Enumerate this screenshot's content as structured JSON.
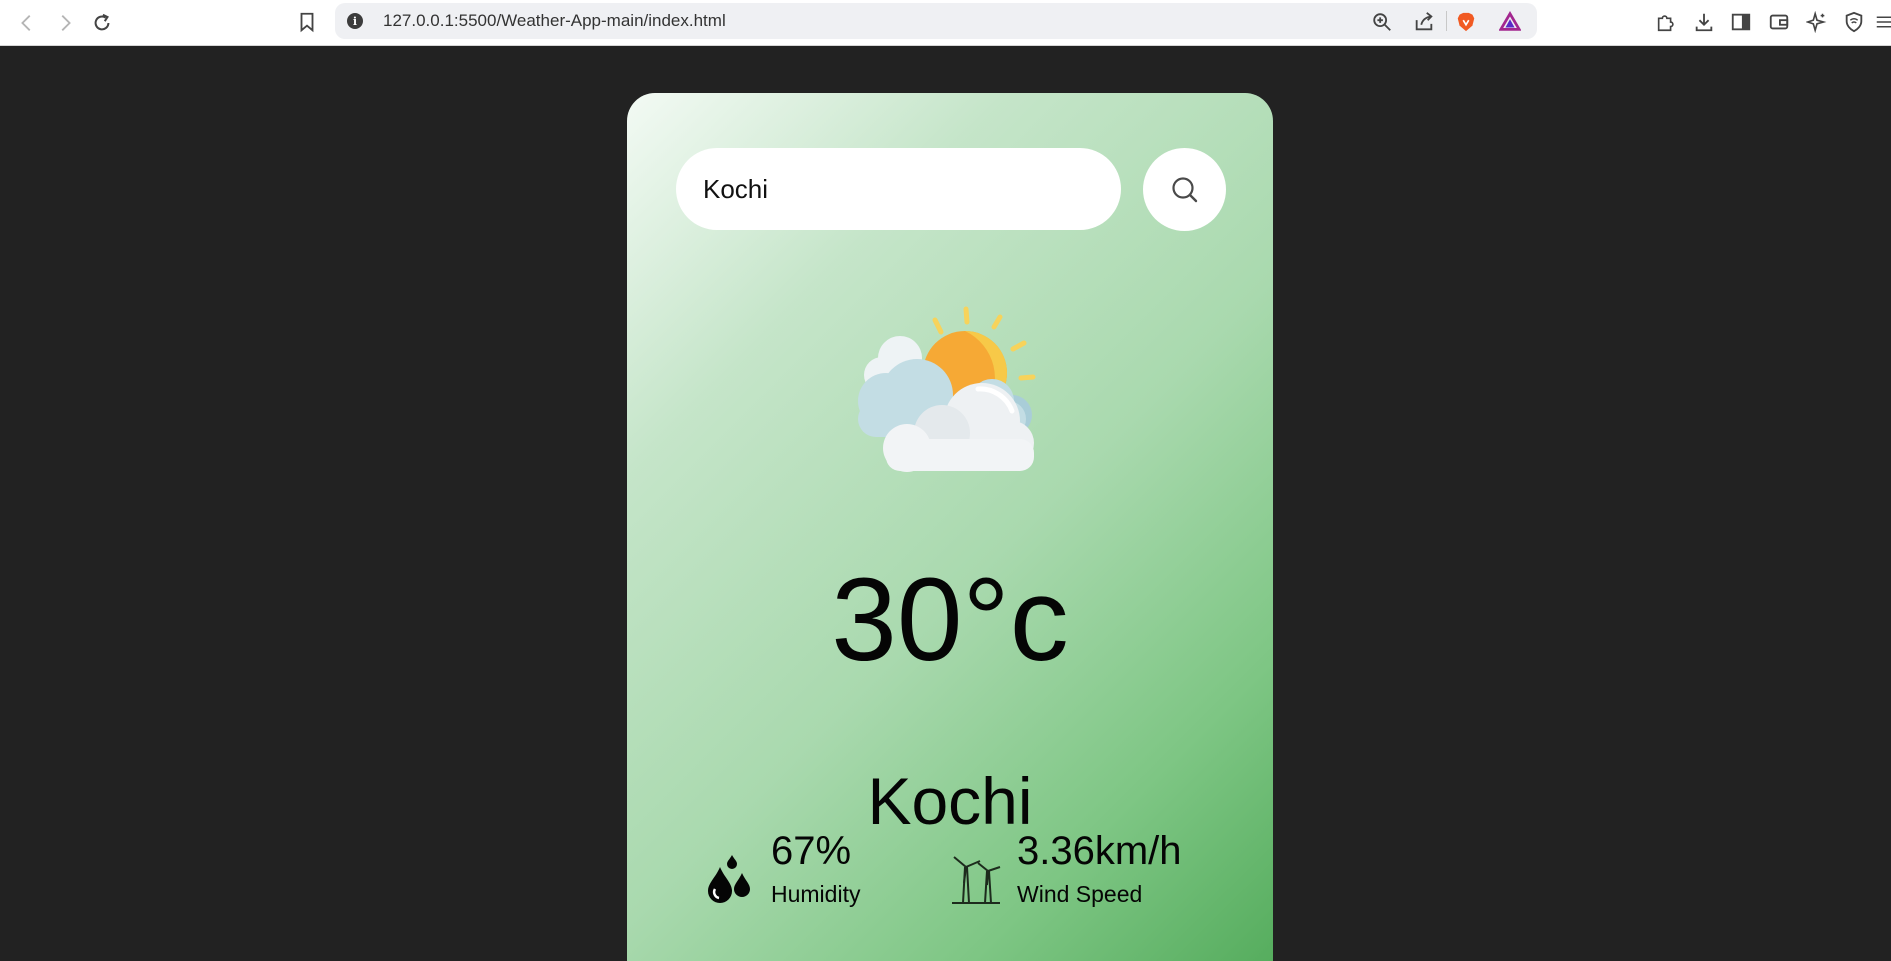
{
  "browser": {
    "url": "127.0.0.1:5500/Weather-App-main/index.html",
    "info_icon": "info-icon"
  },
  "search": {
    "value": "Kochi",
    "button_icon": "search-icon"
  },
  "weather": {
    "icon": "partly-cloudy-icon",
    "temperature": "30°c",
    "city": "Kochi"
  },
  "details": {
    "humidity": {
      "value": "67%",
      "label": "Humidity",
      "icon": "humidity-drops-icon"
    },
    "wind": {
      "value": "3.36km/h",
      "label": "Wind Speed",
      "icon": "wind-turbine-icon"
    }
  },
  "colors": {
    "page_background": "#222222",
    "card_gradient_start": "#f3faf4",
    "card_gradient_end": "#56ad5e"
  }
}
